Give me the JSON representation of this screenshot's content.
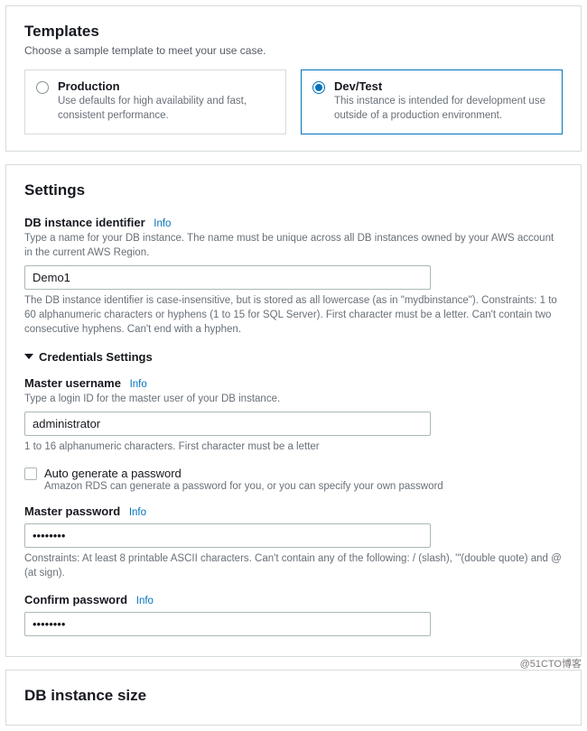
{
  "templates": {
    "title": "Templates",
    "subtitle": "Choose a sample template to meet your use case.",
    "cards": [
      {
        "title": "Production",
        "desc": "Use defaults for high availability and fast, consistent performance.",
        "selected": false
      },
      {
        "title": "Dev/Test",
        "desc": "This instance is intended for development use outside of a production environment.",
        "selected": true
      }
    ]
  },
  "settings": {
    "title": "Settings",
    "identifier": {
      "label": "DB instance identifier",
      "info": "Info",
      "desc": "Type a name for your DB instance. The name must be unique across all DB instances owned by your AWS account in the current AWS Region.",
      "value": "Demo1",
      "hint": "The DB instance identifier is case-insensitive, but is stored as all lowercase (as in \"mydbinstance\"). Constraints: 1 to 60 alphanumeric characters or hyphens (1 to 15 for SQL Server). First character must be a letter. Can't contain two consecutive hyphens. Can't end with a hyphen."
    },
    "credentials": {
      "header": "Credentials Settings",
      "username": {
        "label": "Master username",
        "info": "Info",
        "desc": "Type a login ID for the master user of your DB instance.",
        "value": "administrator",
        "hint": "1 to 16 alphanumeric characters. First character must be a letter"
      },
      "autogen": {
        "label": "Auto generate a password",
        "desc": "Amazon RDS can generate a password for you, or you can specify your own password"
      },
      "password": {
        "label": "Master password",
        "info": "Info",
        "value": "••••••••",
        "hint": "Constraints: At least 8 printable ASCII characters. Can't contain any of the following: / (slash), '\"(double quote) and @ (at sign)."
      },
      "confirm": {
        "label": "Confirm password",
        "info": "Info",
        "value": "••••••••"
      }
    }
  },
  "instance_size": {
    "title": "DB instance size"
  },
  "watermark": "@51CTO博客"
}
